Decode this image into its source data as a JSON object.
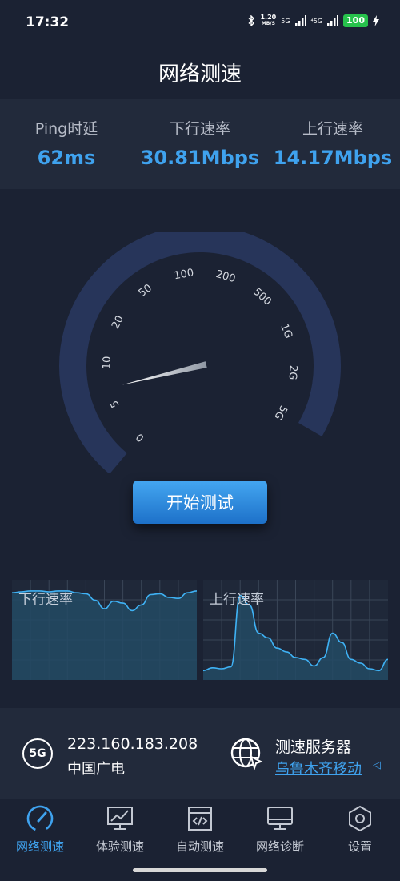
{
  "status_bar": {
    "time": "17:32",
    "net_speed_value": "1.20",
    "net_speed_unit": "MB/S",
    "sim1_label": "5G",
    "sim2_label": "⁴5G",
    "battery": "100",
    "icons": [
      "bluetooth-icon",
      "signal-icon",
      "charging-icon"
    ]
  },
  "header": {
    "title": "网络测速"
  },
  "stats": [
    {
      "label": "Ping时延",
      "value": "62ms"
    },
    {
      "label": "下行速率",
      "value": "30.81Mbps"
    },
    {
      "label": "上行速率",
      "value": "14.17Mbps"
    }
  ],
  "gauge": {
    "ticks": [
      "0",
      "5",
      "10",
      "20",
      "50",
      "100",
      "200",
      "500",
      "1G",
      "2G",
      "5G"
    ],
    "needle_fraction": 0.14,
    "colors": {
      "arc": "#27355a",
      "needle_tip": "#ffffff",
      "needle_base": "#9aa2ad"
    }
  },
  "start_button": {
    "label": "开始测试"
  },
  "graphs": {
    "download_label": "下行速率",
    "upload_label": "上行速率",
    "download_level": [
      0.93,
      0.94,
      0.95,
      0.95,
      0.94,
      0.95,
      0.95,
      0.93,
      0.92,
      0.85,
      0.76,
      0.84,
      0.82,
      0.74,
      0.8,
      0.91,
      0.92,
      0.88,
      0.87,
      0.93,
      0.95
    ],
    "upload_level": [
      0.1,
      0.13,
      0.12,
      0.14,
      0.9,
      0.8,
      0.5,
      0.45,
      0.34,
      0.3,
      0.24,
      0.22,
      0.15,
      0.24,
      0.5,
      0.4,
      0.22,
      0.18,
      0.12,
      0.1,
      0.22
    ],
    "colors": {
      "line": "#3fb2f5",
      "fill": "#234a64",
      "grid": "#3a4658"
    }
  },
  "network": {
    "badge": "5G",
    "ip": "223.160.183.208",
    "isp": "中国广电",
    "server_title": "测速服务器",
    "server_name": "乌鲁木齐移动",
    "server_arrow": "◁"
  },
  "tabs": [
    {
      "label": "网络测速",
      "icon": "speedometer-icon",
      "active": true
    },
    {
      "label": "体验测速",
      "icon": "monitor-chart-icon",
      "active": false
    },
    {
      "label": "自动测速",
      "icon": "code-window-icon",
      "active": false
    },
    {
      "label": "网络诊断",
      "icon": "desktop-icon",
      "active": false
    },
    {
      "label": "设置",
      "icon": "settings-hex-icon",
      "active": false
    }
  ],
  "colors": {
    "background": "#1b2233",
    "panel": "#222a3b",
    "accent": "#3fa2ee"
  }
}
